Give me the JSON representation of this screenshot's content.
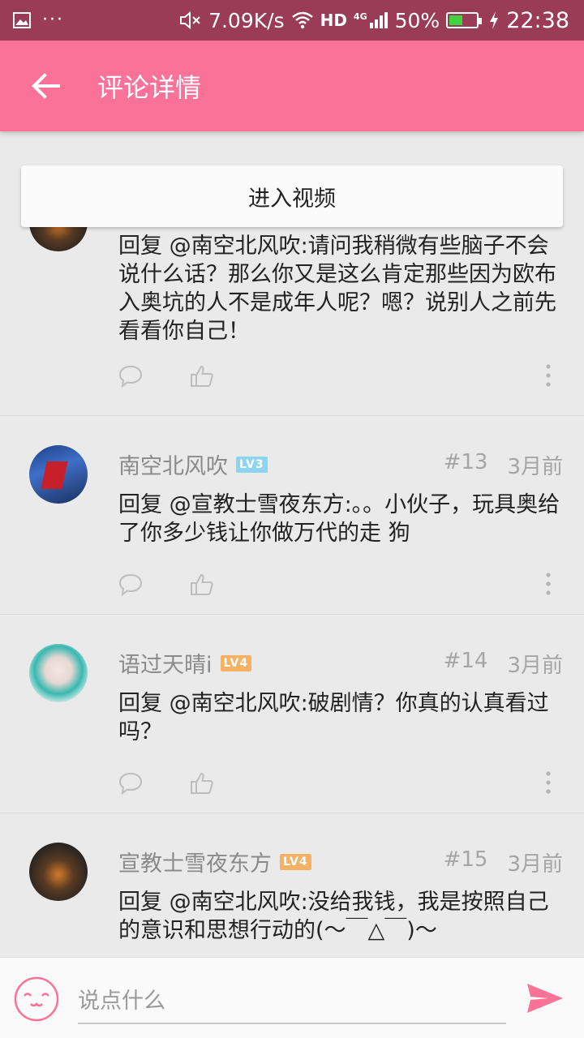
{
  "status_bar": {
    "net_speed": "7.09K/s",
    "network": "HD",
    "network_gen": "4G",
    "battery": "50%",
    "battery_level": 0.5,
    "time": "22:38"
  },
  "toolbar": {
    "title": "评论详情"
  },
  "enter_video_label": "进入视频",
  "comments": [
    {
      "text": "回复 @南空北风吹:请问我稍微有些脑子不会说什么话？那么你又是这么肯定那些因为欧布入奥坑的人不是成年人呢？嗯？说别人之前先看看你自己！"
    },
    {
      "name": "南空北风吹",
      "level": "LV3",
      "floor": "#13",
      "time": "3月前",
      "text": "回复 @宣教士雪夜东方:。。小伙子，玩具奥给了你多少钱让你做万代的走 狗"
    },
    {
      "name": "语过天晴i",
      "level": "LV4",
      "floor": "#14",
      "time": "3月前",
      "text": "回复 @南空北风吹:破剧情？你真的认真看过吗？"
    },
    {
      "name": "宣教士雪夜东方",
      "level": "LV4",
      "floor": "#15",
      "time": "3月前",
      "text": "回复 @南空北风吹:没给我钱，我是按照自己的意识和思想行动的(～￣△￣)～"
    }
  ],
  "input": {
    "placeholder": "说点什么"
  },
  "colors": {
    "accent": "#fb7299",
    "status_bar": "#9a3c55",
    "lv3": "#8cd5f2",
    "lv4": "#f7b163"
  }
}
